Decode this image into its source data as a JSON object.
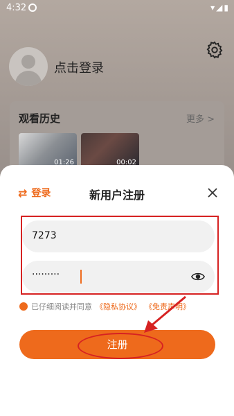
{
  "status_bar": {
    "time": "4:32"
  },
  "profile": {
    "login_prompt": "点击登录"
  },
  "history": {
    "title": "观看历史",
    "more": "更多 >",
    "items": [
      {
        "duration": "01:26"
      },
      {
        "duration": "00:02"
      }
    ]
  },
  "sheet": {
    "switch_login": "登录",
    "title": "新用户注册",
    "account_value": "7273",
    "password_mask": "·········",
    "agree_text": "已仔细阅读并同意",
    "privacy_link": "《隐私协议》",
    "disclaimer_link": "《免责声明》",
    "register_label": "注册"
  },
  "colors": {
    "accent": "#ee6a1c",
    "annotation": "#d62222"
  }
}
